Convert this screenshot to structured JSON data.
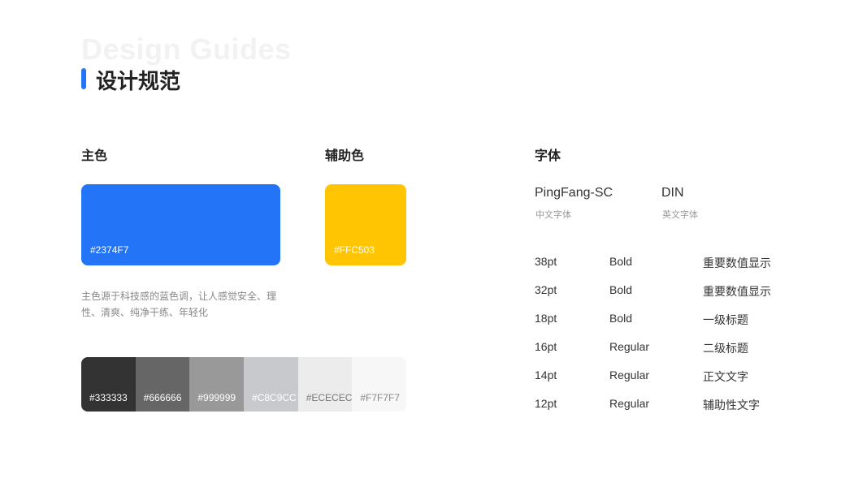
{
  "header": {
    "ghost_title": "Design Guides",
    "title": "设计规范"
  },
  "primary": {
    "label": "主色",
    "color": "#2374F7",
    "code": "#2374F7",
    "description": "主色源于科技感的蓝色调，让人感觉安全、理性、清爽、纯净干练、年轻化"
  },
  "secondary": {
    "label": "辅助色",
    "color": "#FFC503",
    "code": "#FFC503"
  },
  "grays": [
    {
      "code": "#333333",
      "color": "#333333",
      "text_color": "#ffffff"
    },
    {
      "code": "#666666",
      "color": "#666666",
      "text_color": "#ffffff"
    },
    {
      "code": "#999999",
      "color": "#999999",
      "text_color": "#ffffff"
    },
    {
      "code": "#C8C9CC",
      "color": "#C8C9CC",
      "text_color": "#ffffff"
    },
    {
      "code": "#ECECEC",
      "color": "#ECECEC",
      "text_color": "#777777"
    },
    {
      "code": "#F7F7F7",
      "color": "#F7F7F7",
      "text_color": "#888888"
    }
  ],
  "typography": {
    "label": "字体",
    "fonts": [
      {
        "name": "PingFang-SC",
        "sub": "中文字体"
      },
      {
        "name": "DIN",
        "sub": "英文字体"
      }
    ],
    "scale": [
      {
        "size": "38pt",
        "weight": "Bold",
        "usage": "重要数值显示"
      },
      {
        "size": "32pt",
        "weight": "Bold",
        "usage": "重要数值显示"
      },
      {
        "size": "18pt",
        "weight": "Bold",
        "usage": "一级标题"
      },
      {
        "size": "16pt",
        "weight": "Regular",
        "usage": "二级标题"
      },
      {
        "size": "14pt",
        "weight": "Regular",
        "usage": "正文文字"
      },
      {
        "size": "12pt",
        "weight": "Regular",
        "usage": "辅助性文字"
      }
    ]
  }
}
